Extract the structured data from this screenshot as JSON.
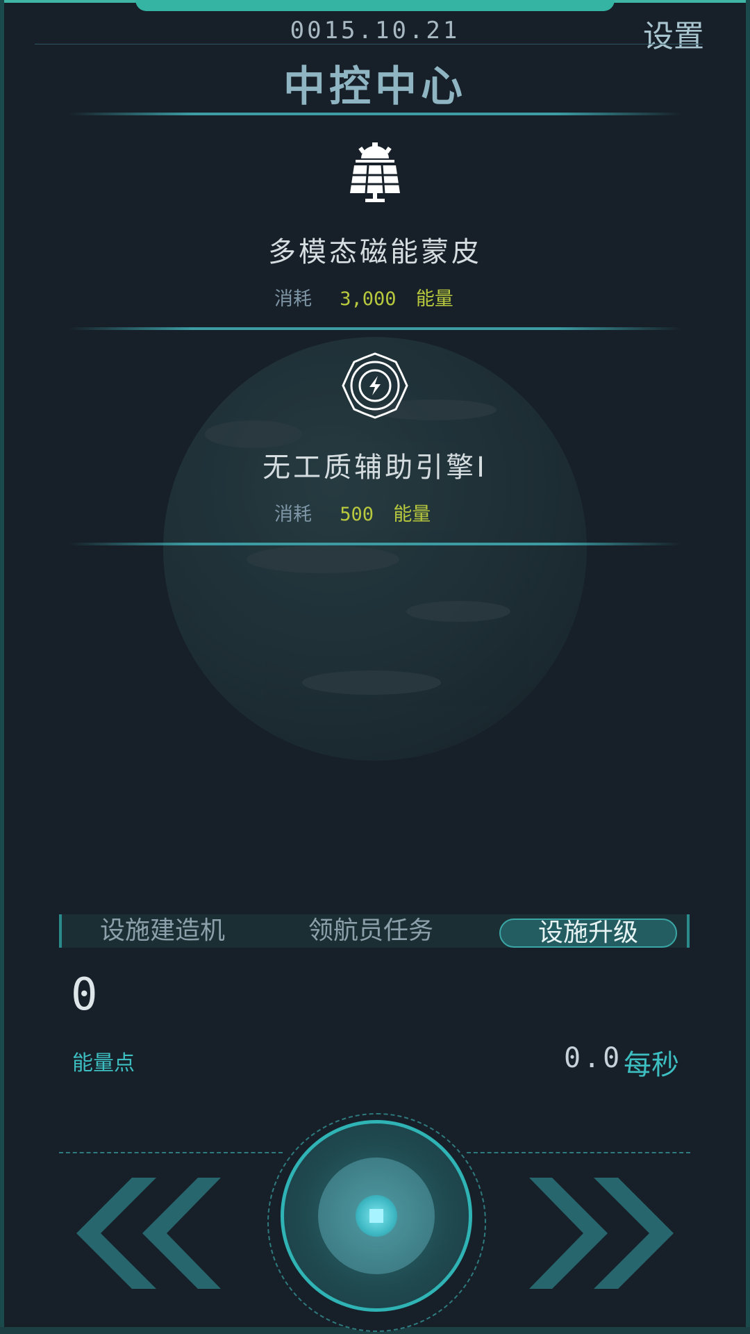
{
  "header": {
    "date": "0015.10.21",
    "settings_label": "设置",
    "title": "中控中心"
  },
  "upgrades": [
    {
      "icon": "solar-panel-icon",
      "name": "多模态磁能蒙皮",
      "cost_label": "消耗",
      "cost_value": "3,000",
      "cost_unit": "能量"
    },
    {
      "icon": "engine-gear-icon",
      "name": "无工质辅助引擎I",
      "cost_label": "消耗",
      "cost_value": "500",
      "cost_unit": "能量"
    }
  ],
  "tabs": [
    {
      "label": "设施建造机",
      "active": false
    },
    {
      "label": "领航员任务",
      "active": false
    },
    {
      "label": "设施升级",
      "active": true
    }
  ],
  "energy": {
    "amount": "0",
    "label": "能量点",
    "rate_value": "0.0",
    "rate_unit": "每秒"
  },
  "controls": {
    "prev_icon": "double-chevron-left-icon",
    "next_icon": "double-chevron-right-icon",
    "center_icon": "stop-icon"
  },
  "colors": {
    "accent": "#3dbfc2",
    "cost": "#b9c93e",
    "background": "#172028"
  }
}
